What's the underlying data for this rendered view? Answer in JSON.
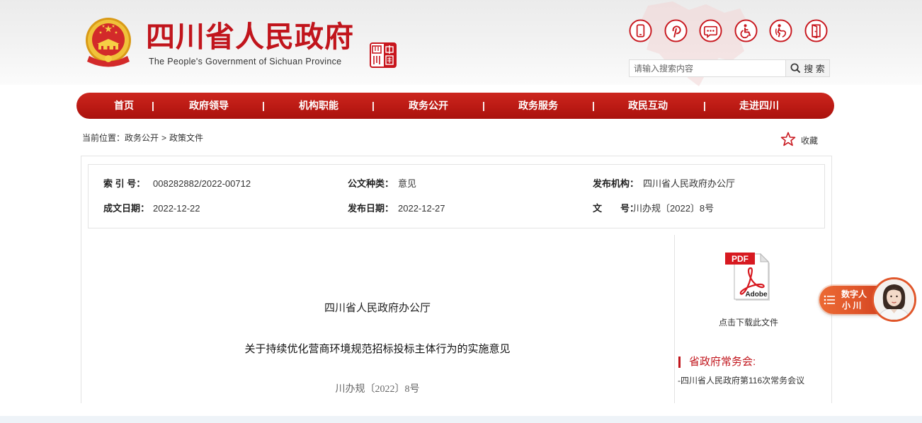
{
  "header": {
    "title": "四川省人民政府",
    "subtitle": "The People's Government of Sichuan Province",
    "emblem_icon": "national-emblem-icon",
    "seal_icon": "sichuan-seal-logo-icon"
  },
  "toolbar": {
    "icons": [
      "mobile-icon",
      "p-letter-icon",
      "chat-icon",
      "wheelchair-icon",
      "elderly-icon",
      "door-icon"
    ]
  },
  "search": {
    "placeholder": "请输入搜索内容",
    "button_label": "搜 索",
    "button_icon": "search-icon"
  },
  "nav": {
    "items": [
      "首页",
      "政府领导",
      "机构职能",
      "政务公开",
      "政务服务",
      "政民互动",
      "走进四川"
    ],
    "separator": "|"
  },
  "breadcrumb": {
    "label": "当前位置：",
    "items": [
      "政务公开",
      "政策文件"
    ],
    "separator": ">"
  },
  "favorite": {
    "icon": "star-icon",
    "label": "收藏"
  },
  "metadata": {
    "index_no": {
      "label": "索 引 号：",
      "value": "008282882/2022-00712"
    },
    "doc_type": {
      "label": "公文种类：",
      "value": "意见"
    },
    "issuer": {
      "label": "发布机构：",
      "value": "四川省人民政府办公厅"
    },
    "created_date": {
      "label": "成文日期：",
      "value": "2022-12-22"
    },
    "published_date": {
      "label": "发布日期：",
      "value": "2022-12-27"
    },
    "doc_number": {
      "label": "文　　号：",
      "value": "川办规〔2022〕8号"
    }
  },
  "document": {
    "issuer": "四川省人民政府办公厅",
    "title": "关于持续优化营商环境规范招标投标主体行为的实施意见",
    "number": "川办规〔2022〕8号"
  },
  "side_panel": {
    "pdf_badge": "PDF",
    "pdf_brand": "Adobe",
    "download_label": "点击下载此文件",
    "meeting_heading": "省政府常务会:",
    "meeting_item": "-四川省人民政府第116次常务会议"
  },
  "assistant": {
    "line1": "数字人",
    "line2": "小 川"
  },
  "colors": {
    "brand_red": "#c1151c",
    "nav_red": "#bb1a14",
    "assistant_orange": "#e0562a",
    "footer_band": "#eef3f8"
  }
}
